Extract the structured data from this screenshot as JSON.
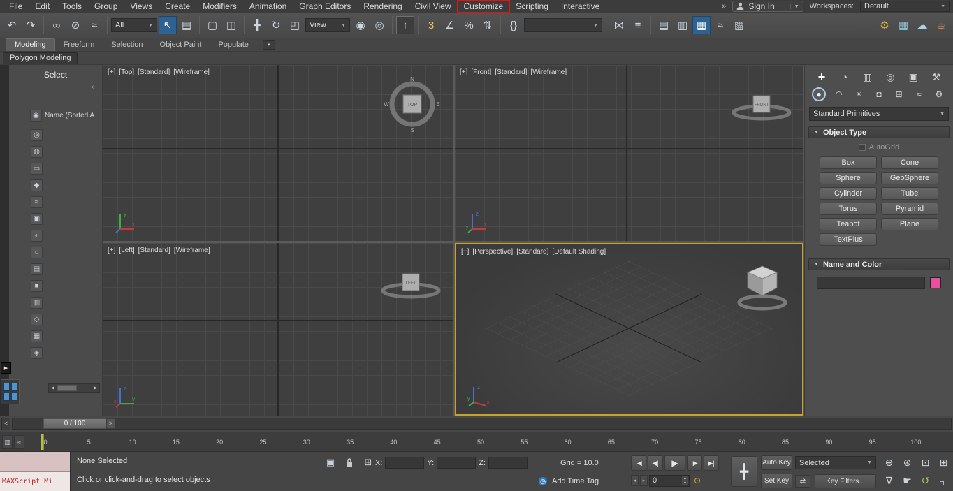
{
  "colors": {
    "highlight_box": "#e21313",
    "active_viewport_border": "#c9a227",
    "object_color": "#e8519e",
    "accent_blue": "#2e6391"
  },
  "menu_bar": {
    "items": [
      {
        "label": "File",
        "name": "menu-file"
      },
      {
        "label": "Edit",
        "name": "menu-edit"
      },
      {
        "label": "Tools",
        "name": "menu-tools"
      },
      {
        "label": "Group",
        "name": "menu-group"
      },
      {
        "label": "Views",
        "name": "menu-views"
      },
      {
        "label": "Create",
        "name": "menu-create"
      },
      {
        "label": "Modifiers",
        "name": "menu-modifiers"
      },
      {
        "label": "Animation",
        "name": "menu-animation"
      },
      {
        "label": "Graph Editors",
        "name": "menu-graph-editors"
      },
      {
        "label": "Rendering",
        "name": "menu-rendering"
      },
      {
        "label": "Civil View",
        "name": "menu-civil-view"
      },
      {
        "label": "Customize",
        "name": "menu-customize",
        "highlight": true
      },
      {
        "label": "Scripting",
        "name": "menu-scripting"
      },
      {
        "label": "Interactive",
        "name": "menu-interactive"
      }
    ],
    "overflow_chevron": "»",
    "sign_in_label": "Sign In",
    "sign_in_arrow": "▼",
    "workspaces_label": "Workspaces:",
    "workspace_value": "Default",
    "workspace_arrow": "▼"
  },
  "toolbar": {
    "selection_filter_value": "All",
    "coord_system_value": "View",
    "named_sets_value": "",
    "dd_arrow": "▼",
    "icons_history": [
      {
        "name": "undo-button",
        "glyph": "↶"
      },
      {
        "name": "redo-button",
        "glyph": "↷"
      }
    ],
    "icons_link": [
      {
        "name": "select-and-link-button",
        "glyph": "∞"
      },
      {
        "name": "unlink-selection-button",
        "glyph": "⊘"
      },
      {
        "name": "bind-to-space-warp-button",
        "glyph": "≈"
      }
    ],
    "icons_select": [
      {
        "name": "select-object-button",
        "glyph": "↖",
        "cls": "active"
      },
      {
        "name": "select-by-name-button",
        "glyph": "▤"
      }
    ],
    "icons_region": [
      {
        "name": "rectangular-selection-region-button",
        "glyph": "▢"
      },
      {
        "name": "window-crossing-button",
        "glyph": "◫"
      }
    ],
    "icons_transform": [
      {
        "name": "select-and-move-button",
        "glyph": "╋"
      },
      {
        "name": "select-and-rotate-button",
        "glyph": "↻"
      },
      {
        "name": "select-and-scale-button",
        "glyph": "◰"
      }
    ],
    "icons_pivot": [
      {
        "name": "use-pivot-point-center-button",
        "glyph": "◉"
      },
      {
        "name": "select-and-manipulate-button",
        "glyph": "◎"
      }
    ],
    "icons_keyboard": [
      {
        "name": "keyboard-shortcut-override-button",
        "glyph": "↑",
        "cls": "pressed"
      }
    ],
    "icons_snaps": [
      {
        "name": "snaps-toggle-button",
        "glyph": "3",
        "color": "#e8c95c"
      },
      {
        "name": "angle-snap-button",
        "glyph": "∠"
      },
      {
        "name": "percent-snap-button",
        "glyph": "%"
      },
      {
        "name": "spinner-snap-button",
        "glyph": "⇅"
      }
    ],
    "icons_sets": [
      {
        "name": "edit-named-selection-sets-button",
        "glyph": "{}"
      }
    ],
    "icons_mirror": [
      {
        "name": "mirror-button",
        "glyph": "⋈"
      },
      {
        "name": "align-button",
        "glyph": "≡"
      }
    ],
    "icons_editors": [
      {
        "name": "toggle-scene-explorer-button",
        "glyph": "▤"
      },
      {
        "name": "toggle-layer-explorer-button",
        "glyph": "▥"
      },
      {
        "name": "toggle-ribbon-button",
        "glyph": "▦",
        "cls": "active"
      },
      {
        "name": "curve-editor-button",
        "glyph": "≈"
      },
      {
        "name": "schematic-view-button",
        "glyph": "▧"
      }
    ],
    "icons_render": [
      {
        "name": "render-setup-button",
        "glyph": "⚙",
        "color": "#e3b341"
      },
      {
        "name": "rendered-frame-window-button",
        "glyph": "▦",
        "color": "#8fc7dd"
      },
      {
        "name": "render-in-cloud-button",
        "glyph": "☁",
        "color": "#a9d3ea"
      },
      {
        "name": "render-production-button",
        "glyph": "☕",
        "color": "#e8964f"
      }
    ]
  },
  "ribbon": {
    "tabs": [
      {
        "label": "Modeling",
        "name": "ribbon-tab-modeling",
        "cls": "active"
      },
      {
        "label": "Freeform",
        "name": "ribbon-tab-freeform"
      },
      {
        "label": "Selection",
        "name": "ribbon-tab-selection"
      },
      {
        "label": "Object Paint",
        "name": "ribbon-tab-object-paint"
      },
      {
        "label": "Populate",
        "name": "ribbon-tab-populate"
      }
    ],
    "tab_options_arrow": "▾",
    "panel_tab": "Polygon Modeling"
  },
  "left_panel": {
    "title": "Select",
    "chevron": "»",
    "name_label": "Name (Sorted A",
    "name_icon": "◉",
    "flyout_arrow": "▶",
    "tools": [
      {
        "name": "modeling-tool-1",
        "glyph": "◎"
      },
      {
        "name": "modeling-tool-2",
        "glyph": "◍"
      },
      {
        "name": "modeling-tool-3",
        "glyph": "▭"
      },
      {
        "name": "modeling-tool-4",
        "glyph": "◆"
      },
      {
        "name": "modeling-tool-5",
        "glyph": "≈"
      },
      {
        "name": "modeling-tool-6",
        "glyph": "▣"
      },
      {
        "name": "modeling-tool-7",
        "glyph": "◐"
      },
      {
        "name": "modeling-tool-8",
        "glyph": "○"
      },
      {
        "name": "modeling-tool-9",
        "glyph": "▤"
      },
      {
        "name": "modeling-tool-10",
        "glyph": "■"
      },
      {
        "name": "modeling-tool-11",
        "glyph": "▥"
      },
      {
        "name": "modeling-tool-12",
        "glyph": "◇"
      },
      {
        "name": "modeling-tool-13",
        "glyph": "▦"
      },
      {
        "name": "modeling-tool-14",
        "glyph": "◈"
      }
    ],
    "scroll_left": "◀",
    "scroll_right": "▶"
  },
  "viewports": {
    "top": {
      "segments": [
        "[+]",
        "[Top]",
        "[Standard]",
        "[Wireframe]"
      ],
      "gizmo_label": "TOP",
      "compass": {
        "n": "N",
        "w": "W",
        "e": "E",
        "s": "S"
      }
    },
    "front": {
      "segments": [
        "[+]",
        "[Front]",
        "[Standard]",
        "[Wireframe]"
      ],
      "gizmo_label": "FRONT"
    },
    "left": {
      "segments": [
        "[+]",
        "[Left]",
        "[Standard]",
        "[Wireframe]"
      ],
      "gizmo_label": "LEFT"
    },
    "perspective": {
      "segments": [
        "[+]",
        "[Perspective]",
        "[Standard]",
        "[Default Shading]"
      ]
    },
    "axis_labels": {
      "x": "x",
      "y": "y",
      "z": "z"
    }
  },
  "command_panel": {
    "tabs": [
      {
        "name": "create-tab",
        "glyph": "+",
        "cls": "active"
      },
      {
        "name": "modify-tab",
        "glyph": "◔"
      },
      {
        "name": "hierarchy-tab",
        "glyph": "▥"
      },
      {
        "name": "motion-tab",
        "glyph": "◎"
      },
      {
        "name": "display-tab",
        "glyph": "▣"
      },
      {
        "name": "utilities-tab",
        "glyph": "⚒"
      }
    ],
    "create_tabs": [
      {
        "name": "geometry-tab",
        "glyph": "●",
        "cls": "active"
      },
      {
        "name": "shapes-tab",
        "glyph": "◠"
      },
      {
        "name": "lights-tab",
        "glyph": "☀"
      },
      {
        "name": "cameras-tab",
        "glyph": "◘"
      },
      {
        "name": "helpers-tab",
        "glyph": "⊞"
      },
      {
        "name": "space-warps-tab",
        "glyph": "≈"
      },
      {
        "name": "systems-tab",
        "glyph": "⚙"
      }
    ],
    "category_value": "Standard Primitives",
    "category_arrow": "▼",
    "object_type_title": "Object Type",
    "rollout_arrow": "▼",
    "autogrid_label": "AutoGrid",
    "object_buttons": [
      "Box",
      "Cone",
      "Sphere",
      "GeoSphere",
      "Cylinder",
      "Tube",
      "Torus",
      "Pyramid",
      "Teapot",
      "Plane",
      "TextPlus"
    ],
    "name_color_title": "Name and Color",
    "name_value": ""
  },
  "time_slider": {
    "value": "0 / 100",
    "back_arrow": "<",
    "forward_arrow": ">"
  },
  "track_bar": {
    "ticks": [
      "0",
      "5",
      "10",
      "15",
      "20",
      "25",
      "30",
      "35",
      "40",
      "45",
      "50",
      "55",
      "60",
      "65",
      "70",
      "75",
      "80",
      "85",
      "90",
      "95",
      "100"
    ],
    "mini_curve_glyph": "≈",
    "mini_mode_glyph": "▥"
  },
  "status_bar": {
    "maxscript_label": "MAXScript Mi",
    "selection_status": "None Selected",
    "prompt": "Click or click-and-drag to select objects",
    "isolate_glyph": "▣",
    "offset_toggle_glyph": "⊞",
    "x_label": "X:",
    "y_label": "Y:",
    "z_label": "Z:",
    "x_value": "",
    "y_value": "",
    "z_value": "",
    "grid_label": "Grid = 10.0",
    "add_time_tag": "Add Time Tag",
    "time_tag_glyph": "◷",
    "frame_value": "0",
    "set_keys_glyph": "╋",
    "key_glyph": "⊙",
    "auto_key": "Auto Key",
    "set_key": "Set Key",
    "key_mode_value": "Selected",
    "key_filters": "Key Filters...",
    "tangent_glyph": "⇄",
    "playback": [
      {
        "name": "go-to-start-button",
        "glyph": "|◀"
      },
      {
        "name": "previous-frame-button",
        "glyph": "◀|"
      },
      {
        "name": "play-button",
        "glyph": "▶",
        "cls": "wide"
      },
      {
        "name": "next-frame-button",
        "glyph": "|▶"
      },
      {
        "name": "go-to-end-button",
        "glyph": "▶|"
      }
    ],
    "nav_icons": [
      {
        "name": "zoom-button",
        "glyph": "⊕"
      },
      {
        "name": "zoom-all-button",
        "glyph": "⊛"
      },
      {
        "name": "zoom-extents-button",
        "glyph": "⊡"
      },
      {
        "name": "zoom-region-button",
        "glyph": "⊞"
      },
      {
        "name": "field-of-view-button",
        "glyph": "∇"
      },
      {
        "name": "pan-button",
        "glyph": "☛"
      },
      {
        "name": "orbit-button",
        "glyph": "↺",
        "color": "#a5c75c"
      },
      {
        "name": "maximize-viewport-button",
        "glyph": "◱"
      }
    ]
  }
}
